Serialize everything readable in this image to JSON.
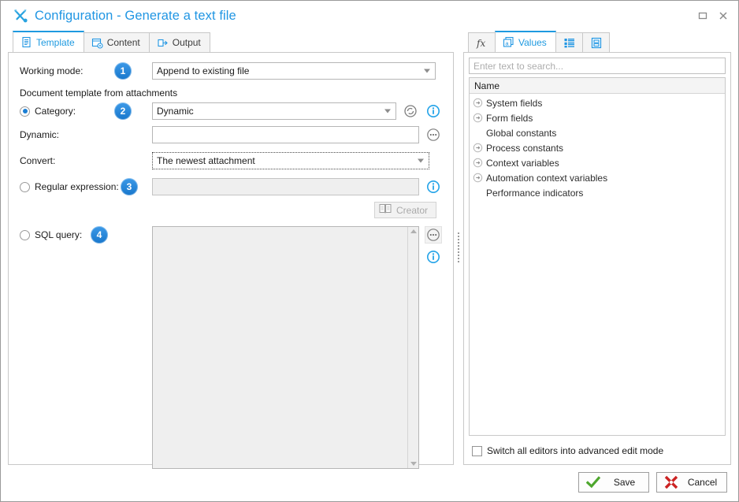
{
  "window": {
    "title": "Configuration - Generate a text file",
    "title_icon": "tools-icon",
    "maximize_label": "Maximize",
    "close_label": "Close"
  },
  "left_tabs": [
    {
      "label": "Template",
      "icon": "document-icon",
      "active": true
    },
    {
      "label": "Content",
      "icon": "content-gear-icon",
      "active": false
    },
    {
      "label": "Output",
      "icon": "output-flow-icon",
      "active": false
    }
  ],
  "form": {
    "working_mode": {
      "label": "Working mode:",
      "badge": "1",
      "value": "Append to existing file"
    },
    "section_title": "Document template from attachments",
    "category": {
      "label": "Category:",
      "badge": "2",
      "value": "Dynamic",
      "selected": true,
      "refresh_icon": "refresh-icon",
      "info_icon": "info-icon"
    },
    "dynamic": {
      "label": "Dynamic:",
      "value": "",
      "ellipsis_icon": "ellipsis-icon"
    },
    "convert": {
      "label": "Convert:",
      "value": "The newest attachment"
    },
    "regular_expression": {
      "label": "Regular expression:",
      "badge": "3",
      "value": "",
      "selected": false,
      "info_icon": "info-icon"
    },
    "creator": {
      "label": "Creator",
      "icon": "book-icon",
      "disabled": true
    },
    "sql_query": {
      "label": "SQL query:",
      "badge": "4",
      "value": "",
      "selected": false,
      "ellipsis_icon": "ellipsis-icon",
      "info_icon": "info-icon"
    }
  },
  "right_panel": {
    "tabs": [
      {
        "label": "",
        "icon": "function-fx-icon",
        "active": false
      },
      {
        "label": "Values",
        "icon": "values-a-icon",
        "active": true
      },
      {
        "label": "",
        "icon": "list-icon",
        "active": false
      },
      {
        "label": "",
        "icon": "form-icon",
        "active": false
      }
    ],
    "search_placeholder": "Enter text to search...",
    "column_header": "Name",
    "tree_items": [
      {
        "label": "System fields",
        "expandable": true
      },
      {
        "label": "Form fields",
        "expandable": true
      },
      {
        "label": "Global constants",
        "expandable": false
      },
      {
        "label": "Process constants",
        "expandable": true
      },
      {
        "label": "Context variables",
        "expandable": true
      },
      {
        "label": "Automation context variables",
        "expandable": true
      },
      {
        "label": "Performance indicators",
        "expandable": false
      }
    ],
    "advanced_mode": {
      "label": "Switch all editors into advanced edit mode",
      "checked": false
    }
  },
  "footer": {
    "save_label": "Save",
    "save_icon": "green-check-icon",
    "cancel_label": "Cancel",
    "cancel_icon": "red-cross-icon"
  },
  "colors": {
    "accent": "#2196e3",
    "badge": "#1877cc",
    "info": "#23a3e8",
    "save": "#4ea72e",
    "cancel": "#cc2222"
  }
}
